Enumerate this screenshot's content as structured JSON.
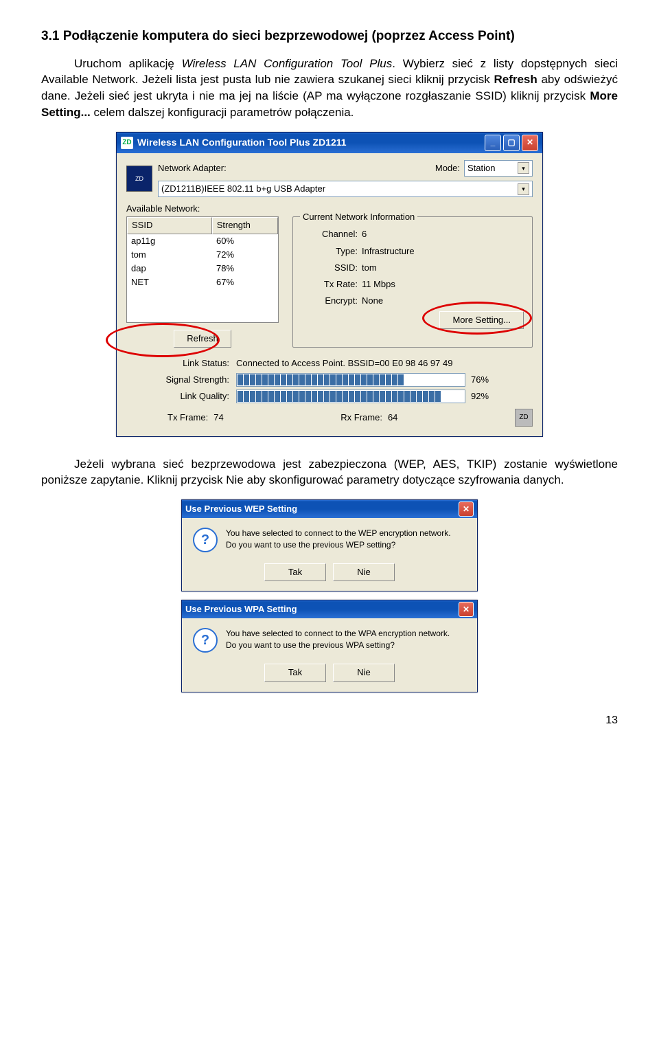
{
  "section_heading": "3.1 Podłączenie komputera do sieci bezprzewodowej (poprzez Access Point)",
  "para1_a": "Uruchom aplikację ",
  "para1_b_italic": "Wireless LAN Configuration Tool Plus",
  "para1_c": ". Wybierz sieć z listy dopstępnych sieci Available Network. Jeżeli lista jest pusta  lub nie zawiera szukanej sieci kliknij przycisk ",
  "para1_d_bold": "Refresh",
  "para1_e": " aby odświeżyć dane. Jeżeli sieć jest ukryta i nie ma jej na liście  (AP ma wyłączone rozgłaszanie SSID) kliknij przycisk ",
  "para1_f_bold": "More Setting...",
  "para1_g": " celem dalszej konfiguracji parametrów połączenia.",
  "tool": {
    "title": "Wireless LAN Configuration Tool Plus   ZD1211",
    "adapter_label": "Network Adapter:",
    "mode_label": "Mode:",
    "mode_value": "Station",
    "adapter_value": "(ZD1211B)IEEE 802.11 b+g USB Adapter",
    "available_label": "Available Network:",
    "table_headers": {
      "ssid": "SSID",
      "strength": "Strength"
    },
    "networks": [
      {
        "ssid": "ap11g",
        "strength": "60%"
      },
      {
        "ssid": "tom",
        "strength": "72%"
      },
      {
        "ssid": "dap",
        "strength": "78%"
      },
      {
        "ssid": "NET",
        "strength": "67%"
      }
    ],
    "refresh_btn": "Refresh",
    "group_title": "Current Network Information",
    "info": {
      "channel_k": "Channel:",
      "channel_v": "6",
      "type_k": "Type:",
      "type_v": "Infrastructure",
      "ssid_k": "SSID:",
      "ssid_v": "tom",
      "txrate_k": "Tx Rate:",
      "txrate_v": "11 Mbps",
      "encrypt_k": "Encrypt:",
      "encrypt_v": "None"
    },
    "more_btn": "More Setting...",
    "status": {
      "link_status_k": "Link Status:",
      "link_status_v": "Connected to Access Point. BSSID=00 E0 98 46 97 49",
      "signal_k": "Signal Strength:",
      "signal_pct": "76%",
      "quality_k": "Link Quality:",
      "quality_pct": "92%",
      "tx_frame_k": "Tx Frame:",
      "tx_frame_v": "74",
      "rx_frame_k": "Rx Frame:",
      "rx_frame_v": "64"
    }
  },
  "para2": "Jeżeli wybrana sieć bezprzewodowa jest zabezpieczona (WEP, AES, TKIP) zostanie wyświetlone poniższe zapytanie. Kliknij przycisk Nie aby skonfigurować parametry dotyczące szyfrowania danych.",
  "dlg_wep": {
    "title": "Use Previous WEP Setting",
    "msg1": "You have selected to connect to the WEP encryption network.",
    "msg2": "Do you want to use the previous WEP setting?",
    "yes": "Tak",
    "no": "Nie"
  },
  "dlg_wpa": {
    "title": "Use Previous WPA Setting",
    "msg1": "You have selected to connect to the WPA encryption network.",
    "msg2": "Do you want to use the previous WPA setting?",
    "yes": "Tak",
    "no": "Nie"
  },
  "page_number": "13"
}
